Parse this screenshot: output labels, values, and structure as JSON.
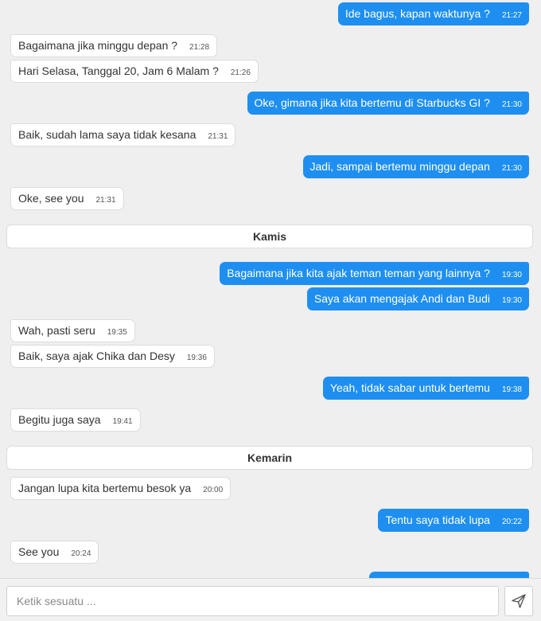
{
  "messages": [
    {
      "dir": "out",
      "text": "Ide bagus, kapan waktunya ?",
      "time": "21:27"
    },
    {
      "dir": "in",
      "text": "Bagaimana jika minggu depan ?",
      "time": "21:28"
    },
    {
      "dir": "in",
      "text": "Hari Selasa, Tanggal 20, Jam 6 Malam ?",
      "time": "21:26"
    },
    {
      "dir": "out",
      "text": "Oke, gimana jika kita bertemu di Starbucks GI ?",
      "time": "21:30"
    },
    {
      "dir": "in",
      "text": "Baik, sudah lama saya tidak kesana",
      "time": "21:31"
    },
    {
      "dir": "out",
      "text": "Jadi, sampai bertemu minggu depan",
      "time": "21:30"
    },
    {
      "dir": "in",
      "text": "Oke, see you",
      "time": "21:31"
    },
    {
      "dir": "out",
      "text": "Bagaimana jika kita ajak teman teman yang lainnya ?",
      "time": "19:30"
    },
    {
      "dir": "out",
      "text": "Saya akan mengajak Andi dan Budi",
      "time": "19:30"
    },
    {
      "dir": "in",
      "text": "Wah, pasti seru",
      "time": "19:35"
    },
    {
      "dir": "in",
      "text": "Baik, saya ajak Chika dan Desy",
      "time": "19:36"
    },
    {
      "dir": "out",
      "text": "Yeah, tidak sabar untuk bertemu",
      "time": "19:38"
    },
    {
      "dir": "in",
      "text": "Begitu juga saya",
      "time": "19:41"
    },
    {
      "dir": "in",
      "text": "Jangan lupa kita bertemu besok ya",
      "time": "20:00"
    },
    {
      "dir": "out",
      "text": "Tentu saya tidak lupa",
      "time": "20:22"
    },
    {
      "dir": "in",
      "text": "See you",
      "time": "20:24"
    }
  ],
  "separators": [
    {
      "label": "Kamis"
    },
    {
      "label": "Kemarin"
    }
  ],
  "composer": {
    "placeholder": "Ketik sesuatu ...",
    "value": ""
  },
  "icons": {
    "send": "send-icon"
  },
  "colors": {
    "outgoing_bubble": "#1e8ff0",
    "incoming_bubble": "#ffffff",
    "background": "#efefef"
  }
}
